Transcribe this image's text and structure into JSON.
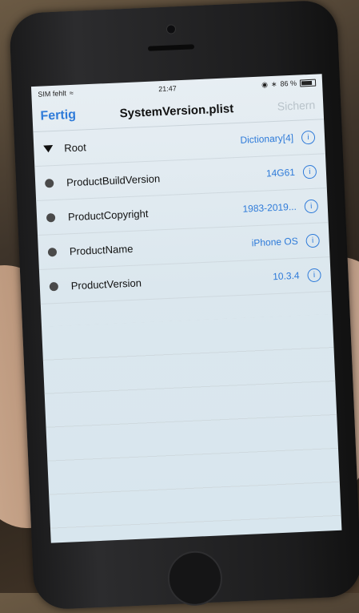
{
  "status": {
    "carrier": "SIM fehlt",
    "time": "21:47",
    "battery": "86 %"
  },
  "nav": {
    "left": "Fertig",
    "title": "SystemVersion.plist",
    "right": "Sichern"
  },
  "rows": [
    {
      "key": "Root",
      "value": "Dictionary[4]"
    },
    {
      "key": "ProductBuildVersion",
      "value": "14G61"
    },
    {
      "key": "ProductCopyright",
      "value": "1983-2019..."
    },
    {
      "key": "ProductName",
      "value": "iPhone OS"
    },
    {
      "key": "ProductVersion",
      "value": "10.3.4"
    }
  ]
}
